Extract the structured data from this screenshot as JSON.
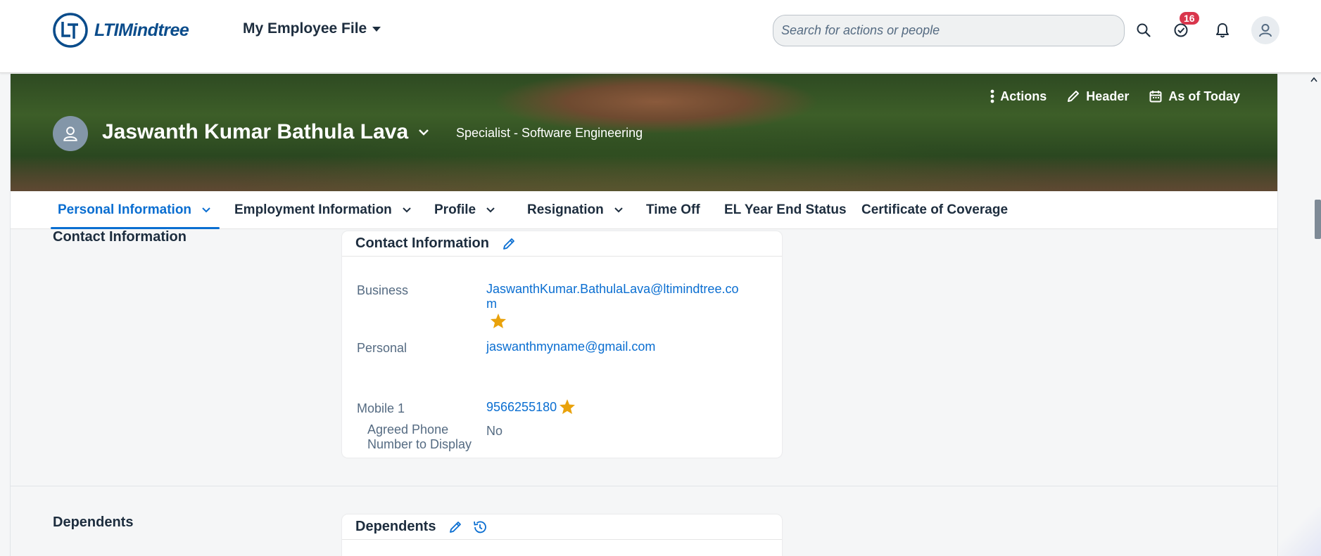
{
  "shell": {
    "logo_text": "LTIMindtree",
    "app_title": "My Employee File",
    "search_placeholder": "Search for actions or people",
    "notifications_count": "16"
  },
  "header": {
    "employee_name": "Jaswanth Kumar Bathula Lava",
    "employee_role": "Specialist - Software Engineering",
    "actions": [
      {
        "label": "Actions",
        "icon": "more-vertical-icon"
      },
      {
        "label": "Header",
        "icon": "pencil-icon"
      },
      {
        "label": "As of Today",
        "icon": "calendar-icon"
      }
    ]
  },
  "tabs": [
    {
      "label": "Personal Information",
      "has_menu": true,
      "active": true
    },
    {
      "label": "Employment Information",
      "has_menu": true
    },
    {
      "label": "Profile",
      "has_menu": true
    },
    {
      "label": "Resignation",
      "has_menu": true
    },
    {
      "label": "Time Off",
      "has_menu": false
    },
    {
      "label": "EL Year End Status",
      "has_menu": false
    },
    {
      "label": "Certificate of Coverage",
      "has_menu": false
    }
  ],
  "contact_section": {
    "section_title": "Contact Information",
    "card_title": "Contact Information",
    "business_label": "Business",
    "business_email_line1": "JaswanthKumar.BathulaLava@ltimindtree.co",
    "business_email_line2": "m",
    "personal_label": "Personal",
    "personal_email": "jaswanthmyname@gmail.com",
    "mobile_label": "Mobile 1",
    "mobile_value": "9566255180",
    "agreed_label_line1": "Agreed Phone",
    "agreed_label_line2": "Number to Display",
    "agreed_value": "No"
  },
  "dependents_section": {
    "section_title": "Dependents",
    "card_title": "Dependents"
  },
  "colors": {
    "accent": "#0a6ed1",
    "star": "#e9a20b",
    "badge": "#d9364c",
    "text": "#1d2d3e",
    "label": "#556b82"
  }
}
